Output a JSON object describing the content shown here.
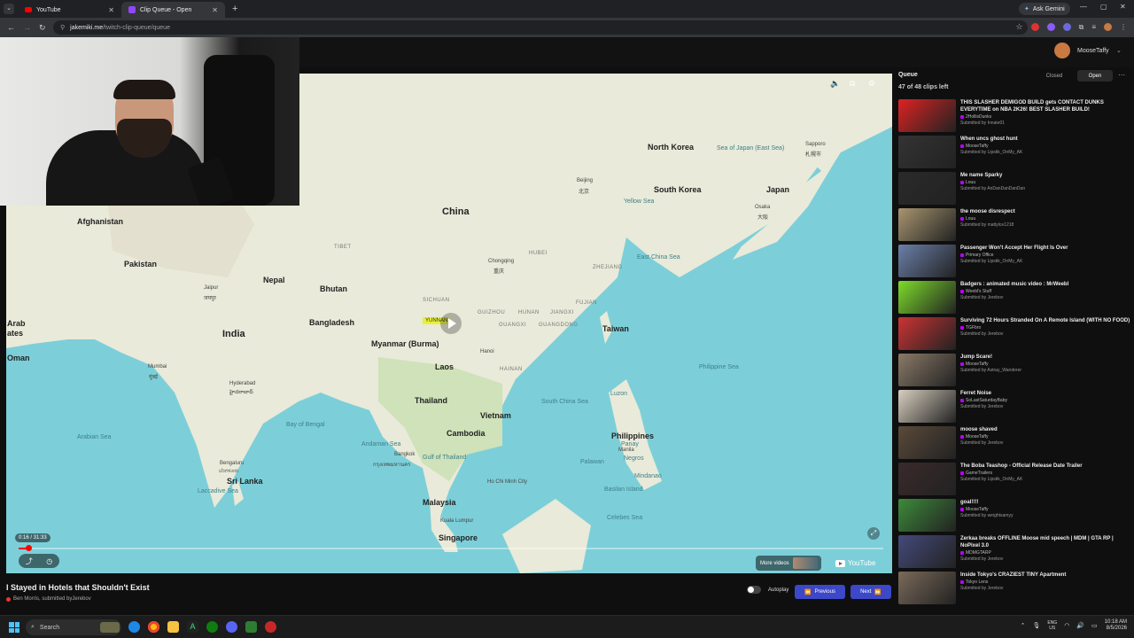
{
  "browser": {
    "tabs": [
      {
        "label": "YouTube",
        "active": false
      },
      {
        "label": "Clip Queue - Open",
        "active": true
      }
    ],
    "ask_gemini": "Ask Gemini",
    "url_host": "jakemiki.me",
    "url_path": "/twitch-clip-queue/queue"
  },
  "user": {
    "name": "MooseTaffy"
  },
  "player": {
    "time": "0:16 / 31:33",
    "progress_fraction": 0.011,
    "more_videos": "More videos",
    "youtube_logo": "YouTube"
  },
  "map": {
    "labels": [
      {
        "t": "Afghanistan",
        "c": "country"
      },
      {
        "t": "Pakistan",
        "c": "country"
      },
      {
        "t": "China",
        "c": "big"
      },
      {
        "t": "Nepal",
        "c": "country"
      },
      {
        "t": "Bhutan",
        "c": "country"
      },
      {
        "t": "India",
        "c": "big"
      },
      {
        "t": "Bangladesh",
        "c": "country"
      },
      {
        "t": "Myanmar (Burma)",
        "c": "country"
      },
      {
        "t": "Laos",
        "c": "country"
      },
      {
        "t": "Thailand",
        "c": "country"
      },
      {
        "t": "Vietnam",
        "c": "country"
      },
      {
        "t": "Cambodia",
        "c": "country"
      },
      {
        "t": "Philippines",
        "c": "country"
      },
      {
        "t": "Taiwan",
        "c": "country"
      },
      {
        "t": "North Korea",
        "c": "country"
      },
      {
        "t": "South Korea",
        "c": "country"
      },
      {
        "t": "Japan",
        "c": "country"
      },
      {
        "t": "Malaysia",
        "c": "country"
      },
      {
        "t": "Singapore",
        "c": "country"
      },
      {
        "t": "Sri Lanka",
        "c": "country"
      },
      {
        "t": "Oman",
        "c": "country"
      },
      {
        "t": "Arab",
        "c": "country"
      },
      {
        "t": "ates",
        "c": "country"
      },
      {
        "t": "Beijing",
        "c": "small"
      },
      {
        "t": "北京",
        "c": "small"
      },
      {
        "t": "Chongqing",
        "c": "small"
      },
      {
        "t": "重庆",
        "c": "small"
      },
      {
        "t": "Hanoi",
        "c": "small"
      },
      {
        "t": "Bangkok",
        "c": "small"
      },
      {
        "t": "กรุงเทพมหานคร",
        "c": "small"
      },
      {
        "t": "Ho Chi Minh City",
        "c": "small"
      },
      {
        "t": "Manila",
        "c": "small"
      },
      {
        "t": "Kuala Lumpur",
        "c": "small"
      },
      {
        "t": "Jaipur",
        "c": "small"
      },
      {
        "t": "जयपुर",
        "c": "small"
      },
      {
        "t": "Mumbai",
        "c": "small"
      },
      {
        "t": "मुंबई",
        "c": "small"
      },
      {
        "t": "Hyderabad",
        "c": "small"
      },
      {
        "t": "హైదరాబాద్",
        "c": "small"
      },
      {
        "t": "Bengaluru",
        "c": "small"
      },
      {
        "t": "ಬೆಂಗಳೂರು",
        "c": "small"
      },
      {
        "t": "Osaka",
        "c": "small"
      },
      {
        "t": "大阪",
        "c": "small"
      },
      {
        "t": "Sapporo",
        "c": "small"
      },
      {
        "t": "札幌市",
        "c": "small"
      },
      {
        "t": "Arabian Sea",
        "c": "sea"
      },
      {
        "t": "Bay of Bengal",
        "c": "sea"
      },
      {
        "t": "Andaman Sea",
        "c": "sea"
      },
      {
        "t": "Laccadive Sea",
        "c": "sea"
      },
      {
        "t": "South China Sea",
        "c": "sea"
      },
      {
        "t": "East China Sea",
        "c": "sea"
      },
      {
        "t": "Yellow Sea",
        "c": "sea"
      },
      {
        "t": "Sea of Japan (East Sea)",
        "c": "sea"
      },
      {
        "t": "Philippine Sea",
        "c": "sea"
      },
      {
        "t": "Celebes Sea",
        "c": "sea"
      },
      {
        "t": "Gulf of Thailand",
        "c": "sea"
      },
      {
        "t": "Luzon",
        "c": "sea"
      },
      {
        "t": "Panay",
        "c": "sea"
      },
      {
        "t": "Negros",
        "c": "sea"
      },
      {
        "t": "Palawan",
        "c": "sea"
      },
      {
        "t": "Mindanao",
        "c": "sea"
      },
      {
        "t": "Basilan Island",
        "c": "sea"
      },
      {
        "t": "TIBET",
        "c": "region"
      },
      {
        "t": "SICHUAN",
        "c": "region"
      },
      {
        "t": "GUIZHOU",
        "c": "region"
      },
      {
        "t": "HUNAN",
        "c": "region"
      },
      {
        "t": "JIANGXI",
        "c": "region"
      },
      {
        "t": "FUJIAN",
        "c": "region"
      },
      {
        "t": "GUANGXI",
        "c": "region"
      },
      {
        "t": "GUANGDONG",
        "c": "region"
      },
      {
        "t": "HAINAN",
        "c": "region"
      },
      {
        "t": "ZHEJIANG",
        "c": "region"
      },
      {
        "t": "HUBEI",
        "c": "region"
      }
    ],
    "highlight": "YUNNAN"
  },
  "video": {
    "title": "I Stayed in Hotels that Shouldn't Exist",
    "channel": "Ben Morris",
    "submitted_prefix": ", submitted by",
    "submitter": "Jerebov"
  },
  "controls": {
    "autoplay": "Autoplay",
    "previous": "Previous",
    "next": "Next"
  },
  "queue": {
    "title": "Queue",
    "count": "47 of 48 clips left",
    "closed": "Closed",
    "open": "Open",
    "items": [
      {
        "title": "THIS SLASHER DEMIGOD BUILD gets CONTACT DUNKS EVERYTIME on NBA 2K26! BEST SLASHER BUILD!",
        "channel": "2HollisDunks",
        "submitted": "Submitted by Innate01",
        "color": "#d22"
      },
      {
        "title": "When uncs ghost hunt",
        "channel": "MooseTaffy",
        "submitted": "Submitted by Lipstik_OnMy_AK",
        "color": "#333"
      },
      {
        "title": "Me name Sparky",
        "channel": "Louu",
        "submitted": "Submitted by AnDanDanDanDan",
        "color": "#2a2a2a"
      },
      {
        "title": "the moose disrespect",
        "channel": "Louu",
        "submitted": "Submitted by mattylce1218",
        "color": "#a89570"
      },
      {
        "title": "Passenger Won't Accept Her Flight Is Over",
        "channel": "Primary Office",
        "submitted": "Submitted by Lipstik_OnMy_AK",
        "color": "#6b7fa8"
      },
      {
        "title": "Badgers : animated music video : MrWeebl",
        "channel": "Weebl's Stuff",
        "submitted": "Submitted by Jerebov",
        "color": "#7ddc2a"
      },
      {
        "title": "Surviving 72 Hours Stranded On A Remote Island (WITH NO FOOD)",
        "channel": "TGFbro",
        "submitted": "Submitted by Jerebov",
        "color": "#c33"
      },
      {
        "title": "Jump Scare!",
        "channel": "MooseTaffy",
        "submitted": "Submitted by Astray_Wanderer",
        "color": "#8a7a68"
      },
      {
        "title": "Ferret Noise",
        "channel": "SoLastSaturdayBaby",
        "submitted": "Submitted by Jerebov",
        "color": "#d8cfbf"
      },
      {
        "title": "moose shaved",
        "channel": "MooseTaffy",
        "submitted": "Submitted by Jerebov",
        "color": "#5a4a3a"
      },
      {
        "title": "The Boba Teashop - Official Release Date Trailer",
        "channel": "GameTrailers",
        "submitted": "Submitted by Lipstik_OnMy_AK",
        "color": "#3a2a2a"
      },
      {
        "title": "goal!!!!",
        "channel": "MooseTaffy",
        "submitted": "Submitted by weightsamyy",
        "color": "#3d8a3a"
      },
      {
        "title": "Zerkaa breaks OFFLINE Moose mid speech | MDM | GTA RP | NoPixel 3.0",
        "channel": "MDMGTARP",
        "submitted": "Submitted by Jerebov",
        "color": "#444a7a"
      },
      {
        "title": "Inside Tokyo's CRAZIEST TINY Apartment",
        "channel": "Tokyo Lens",
        "submitted": "Submitted by Jerebov",
        "color": "#7a6a5a"
      }
    ]
  },
  "taskbar": {
    "search": "Search",
    "lang_1": "ENG",
    "lang_2": "US",
    "time": "10:18 AM",
    "date": "8/5/2026"
  }
}
